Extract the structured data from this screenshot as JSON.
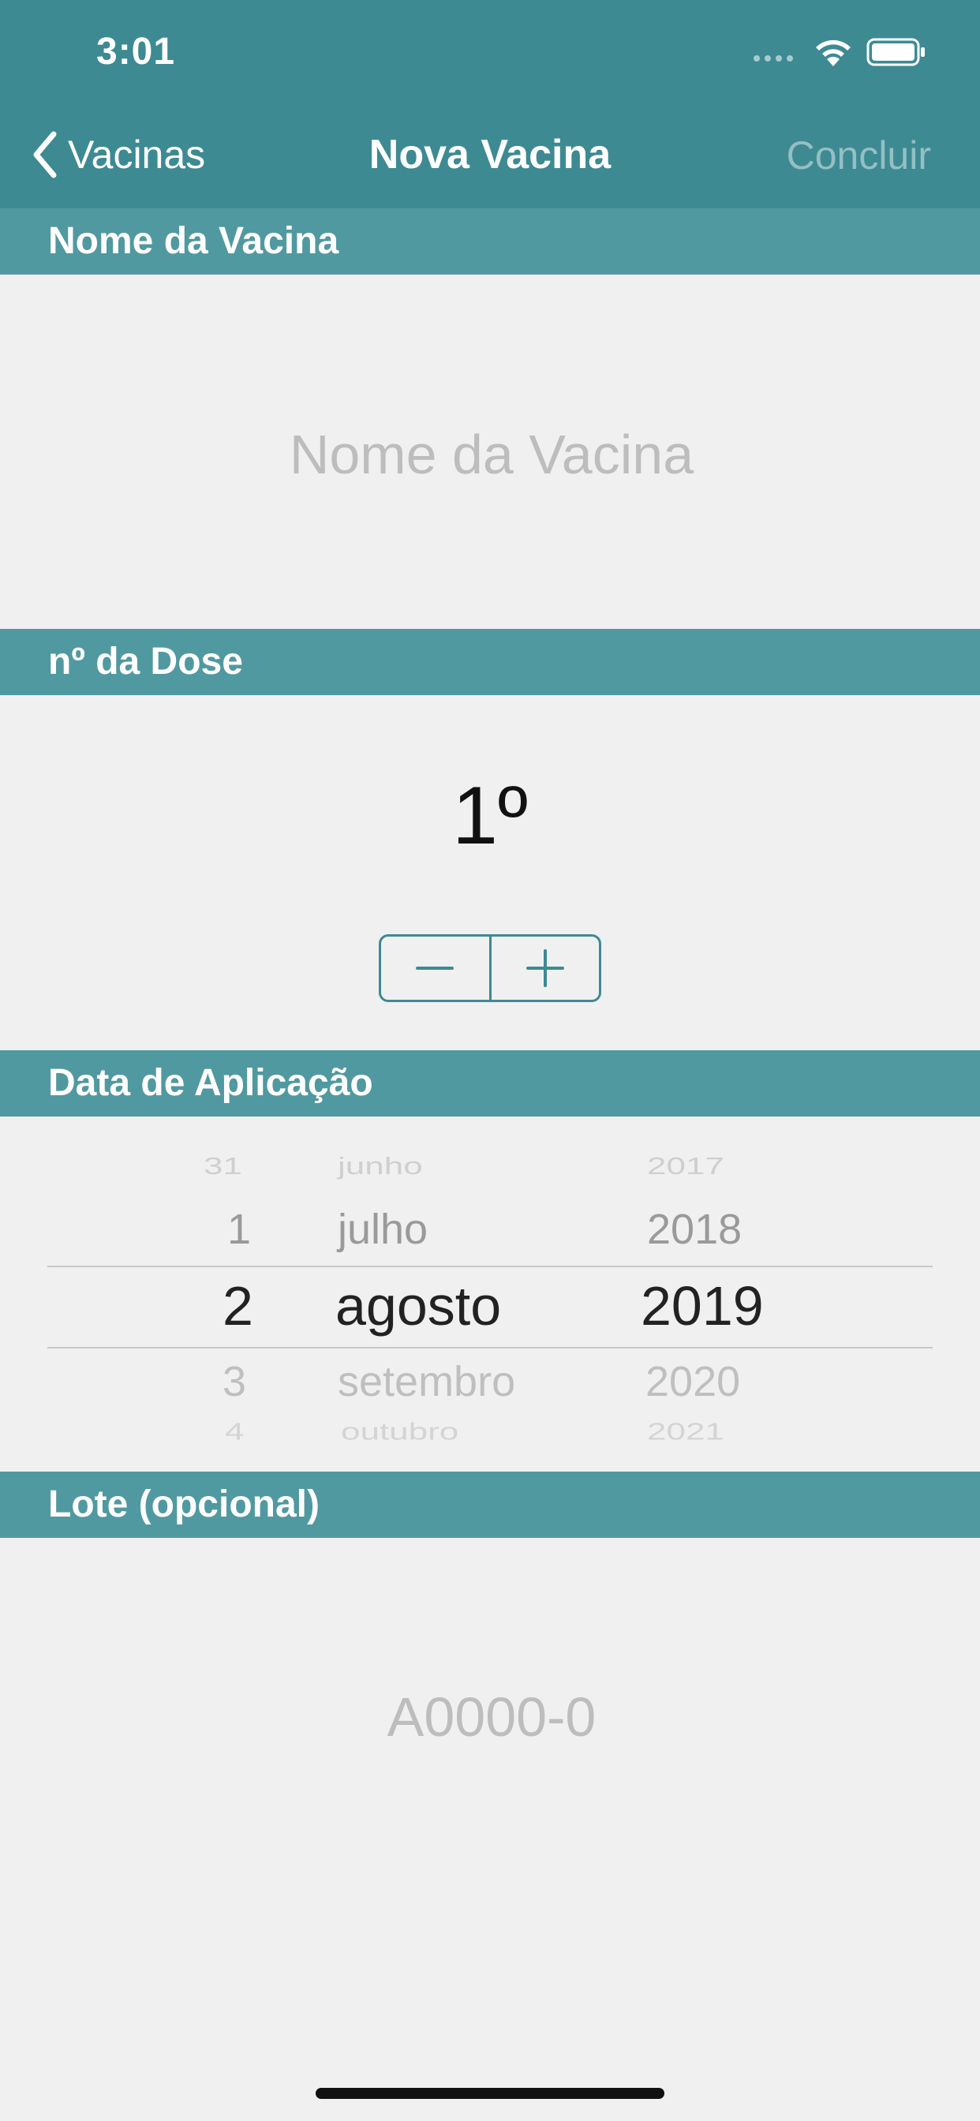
{
  "status_bar": {
    "time": "3:01"
  },
  "nav": {
    "back_label": "Vacinas",
    "title": "Nova Vacina",
    "done_label": "Concluir"
  },
  "sections": {
    "vaccine_name": {
      "header": "Nome da Vacina",
      "placeholder": "Nome da Vacina"
    },
    "dose": {
      "header": "nº da Dose",
      "value": "1º"
    },
    "date": {
      "header": "Data de Aplicação",
      "days": [
        "31",
        "1",
        "2",
        "3",
        "4"
      ],
      "months": [
        "junho",
        "julho",
        "agosto",
        "setembro",
        "outubro"
      ],
      "years": [
        "2017",
        "2018",
        "2019",
        "2020",
        "2021"
      ],
      "selected": {
        "day": "2",
        "month": "agosto",
        "year": "2019"
      }
    },
    "lot": {
      "header": "Lote (opcional)",
      "placeholder": "A0000-0"
    }
  },
  "colors": {
    "nav_bar": "#3d8a93",
    "section_header": "#5199a0",
    "background": "#f0f0f0",
    "accent": "#3d8a93"
  }
}
